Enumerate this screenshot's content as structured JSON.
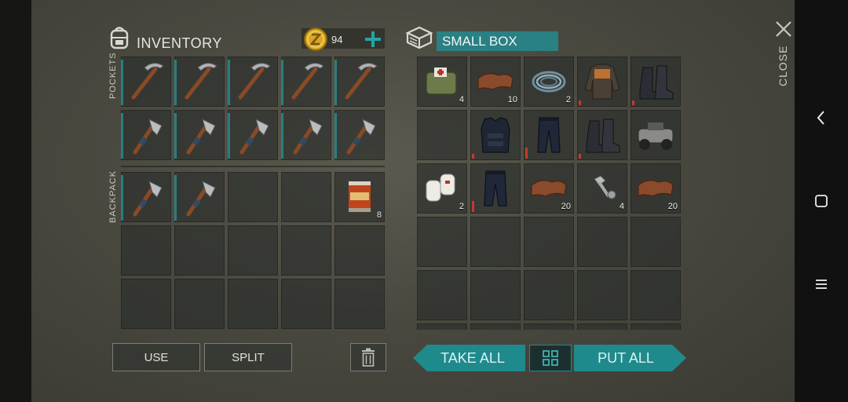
{
  "inventory": {
    "title": "INVENTORY",
    "coins": "94",
    "add_icon": "plus-icon",
    "pockets_label": "POCKETS",
    "backpack_label": "BACKPACK",
    "pocket_items": [
      "pickaxe",
      "pickaxe",
      "pickaxe",
      "pickaxe",
      "pickaxe",
      "hatchet",
      "hatchet",
      "hatchet",
      "hatchet",
      "hatchet"
    ],
    "backpack_items": [
      {
        "item": "hatchet",
        "qty": ""
      },
      {
        "item": "hatchet",
        "qty": ""
      },
      {
        "item": "",
        "qty": ""
      },
      {
        "item": "",
        "qty": ""
      },
      {
        "item": "canned-food",
        "qty": "8"
      }
    ]
  },
  "box": {
    "title": "SMALL BOX",
    "items": [
      {
        "item": "first-aid-bag",
        "qty": "4"
      },
      {
        "item": "leather",
        "qty": "10"
      },
      {
        "item": "wire",
        "qty": "2"
      },
      {
        "item": "jacket",
        "qty": ""
      },
      {
        "item": "boots",
        "qty": ""
      },
      {
        "item": "",
        "qty": ""
      },
      {
        "item": "police-vest",
        "qty": ""
      },
      {
        "item": "police-pants",
        "qty": ""
      },
      {
        "item": "boots",
        "qty": ""
      },
      {
        "item": "atv",
        "qty": ""
      },
      {
        "item": "bandages",
        "qty": "2"
      },
      {
        "item": "police-pants",
        "qty": ""
      },
      {
        "item": "leather",
        "qty": "20"
      },
      {
        "item": "bolts",
        "qty": "4"
      },
      {
        "item": "leather",
        "qty": "20"
      }
    ]
  },
  "buttons": {
    "use": "USE",
    "split": "SPLIT",
    "take_all": "TAKE ALL",
    "put_all": "PUT ALL",
    "close": "CLOSE"
  },
  "colors": {
    "accent": "#1f8a8c",
    "durability": "#c43a2b"
  }
}
